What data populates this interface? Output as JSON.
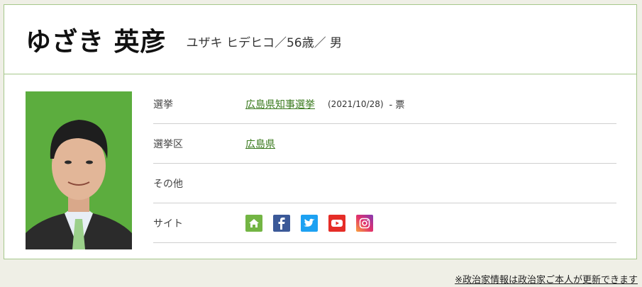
{
  "profile": {
    "name": "ゆざき 英彦",
    "meta": "ユザキ ヒデヒコ／56歳／ 男"
  },
  "rows": [
    {
      "label": "選挙",
      "link": "広島県知事選挙",
      "date": "(2021/10/28)",
      "votes": "- 票"
    },
    {
      "label": "選挙区",
      "link": "広島県"
    },
    {
      "label": "その他"
    },
    {
      "label": "サイト"
    }
  ],
  "social": [
    {
      "icon": "home-icon",
      "color": "#73b544"
    },
    {
      "icon": "facebook-icon",
      "color": "#3b5998"
    },
    {
      "icon": "twitter-icon",
      "color": "#1da1f2"
    },
    {
      "icon": "youtube-icon",
      "color": "#e52d27"
    },
    {
      "icon": "instagram-icon",
      "color": "#c13584"
    }
  ],
  "footer": "※政治家情報は政治家ご本人が更新できます"
}
